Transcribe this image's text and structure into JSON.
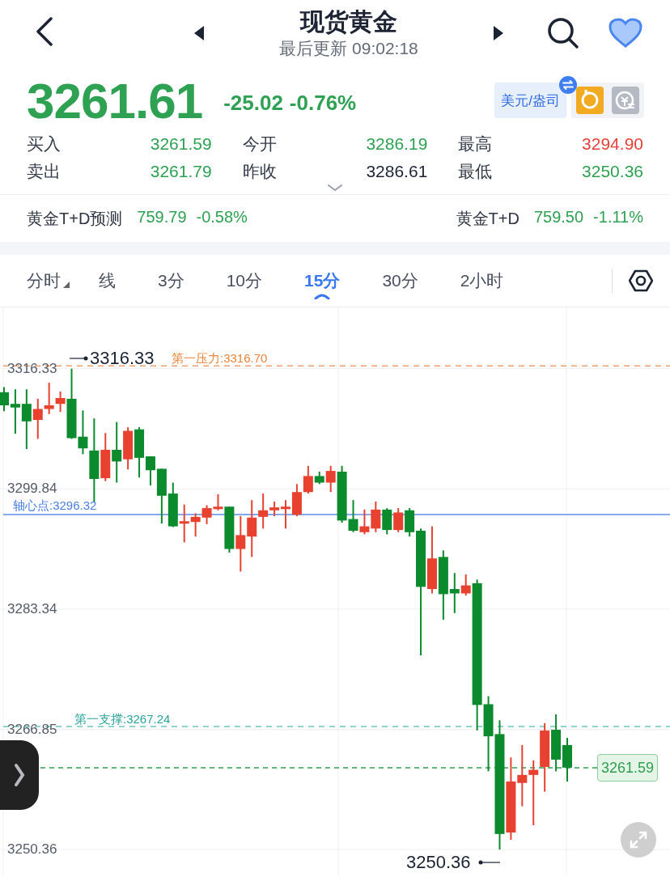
{
  "header": {
    "title": "现货黄金",
    "subtitle": "最后更新 09:02:18",
    "favorite": true
  },
  "quote": {
    "price": "3261.61",
    "change": "-25.02",
    "change_percent": "-0.76%",
    "color": "#2ea152",
    "unit_button": "美元/盎司"
  },
  "stats": [
    {
      "label": "买入",
      "value": "3261.59",
      "color": "#2ea152"
    },
    {
      "label": "今开",
      "value": "3286.19",
      "color": "#2ea152"
    },
    {
      "label": "最高",
      "value": "3294.90",
      "color": "#e5423a"
    },
    {
      "label": "卖出",
      "value": "3261.79",
      "color": "#2ea152"
    },
    {
      "label": "昨收",
      "value": "3286.61",
      "color": "#1c2333"
    },
    {
      "label": "最低",
      "value": "3250.36",
      "color": "#2ea152"
    }
  ],
  "related": [
    {
      "name": "黄金T+D预测",
      "price": "759.79",
      "change_percent": "-0.58%",
      "color": "#2ea152"
    },
    {
      "name": "黄金T+D",
      "price": "759.50",
      "change_percent": "-1.11%",
      "color": "#2ea152"
    }
  ],
  "period_tabs": [
    {
      "label": "分时",
      "selected": false,
      "dropdown": true
    },
    {
      "label": "线",
      "selected": false,
      "dropdown": false
    },
    {
      "label": "3分",
      "selected": false,
      "dropdown": false
    },
    {
      "label": "10分",
      "selected": false,
      "dropdown": false
    },
    {
      "label": "15分",
      "selected": true,
      "dropdown": false
    },
    {
      "label": "30分",
      "selected": false,
      "dropdown": false
    },
    {
      "label": "2小时",
      "selected": false,
      "dropdown": false
    }
  ],
  "chart": {
    "high_marker": "3316.33",
    "low_marker": "3250.36",
    "chart_data": {
      "type": "candlestick",
      "categories": [
        null,
        null,
        null,
        null,
        null,
        null,
        null,
        null,
        null,
        null,
        null,
        null,
        null,
        null,
        null,
        null,
        null,
        null,
        null,
        null,
        null,
        null,
        null,
        null,
        null,
        null,
        null,
        null,
        null,
        null,
        null,
        null,
        null,
        null,
        null,
        null,
        null,
        null,
        null,
        null,
        null,
        null,
        null,
        null,
        null,
        null,
        null,
        null,
        null,
        null,
        null
      ],
      "yticks": [
        3316.33,
        3299.84,
        3283.34,
        3266.85,
        3250.36
      ],
      "ylim": [
        3246.82,
        3324.73
      ],
      "grid": true,
      "ref_lines": [
        {
          "axis": "y",
          "value": 3316.7,
          "color": "#f0a070",
          "label": "第一压力:3316.70"
        },
        {
          "axis": "y",
          "value": 3296.32,
          "color": "#5b8ee8",
          "label": "轴心点:3296.32"
        },
        {
          "axis": "y",
          "value": 3267.24,
          "color": "#6cc6c0",
          "label": "第一支撑:3267.24"
        },
        {
          "axis": "y",
          "value": 3261.59,
          "color": "#2f9e4f",
          "label": "3261.59"
        }
      ],
      "ohlc": [
        [
          3313.1,
          3313.8,
          3310.5,
          3311.3
        ],
        [
          3311.5,
          3313.5,
          3307.4,
          3311.0
        ],
        [
          3311.5,
          3313.5,
          3305.3,
          3309.1
        ],
        [
          3309.3,
          3312.2,
          3306.7,
          3310.8
        ],
        [
          3310.8,
          3314.4,
          3310.1,
          3311.3
        ],
        [
          3311.5,
          3313.2,
          3310.4,
          3312.3
        ],
        [
          3312.2,
          3316.33,
          3306.7,
          3306.8
        ],
        [
          3307.0,
          3310.6,
          3304.6,
          3305.4
        ],
        [
          3305.1,
          3309.5,
          3298.0,
          3301.2
        ],
        [
          3301.3,
          3307.5,
          3300.9,
          3305.2
        ],
        [
          3305.2,
          3309.0,
          3300.7,
          3303.6
        ],
        [
          3303.9,
          3308.3,
          3302.5,
          3307.8
        ],
        [
          3308.0,
          3308.3,
          3301.4,
          3304.1
        ],
        [
          3304.3,
          3304.3,
          3300.3,
          3302.4
        ],
        [
          3302.6,
          3302.6,
          3295.1,
          3298.9
        ],
        [
          3299.2,
          3300.7,
          3294.6,
          3294.7
        ],
        [
          3295.1,
          3297.7,
          3292.5,
          3295.4
        ],
        [
          3295.3,
          3296.5,
          3293.3,
          3296.0
        ],
        [
          3295.9,
          3297.6,
          3295.0,
          3297.2
        ],
        [
          3297.1,
          3299.1,
          3296.9,
          3297.4
        ],
        [
          3297.4,
          3297.4,
          3291.1,
          3291.6
        ],
        [
          3291.6,
          3296.1,
          3288.5,
          3293.5
        ],
        [
          3293.3,
          3298.3,
          3290.5,
          3295.9
        ],
        [
          3296.0,
          3299.2,
          3294.4,
          3296.9
        ],
        [
          3296.9,
          3298.1,
          3296.1,
          3297.3
        ],
        [
          3297.1,
          3298.3,
          3294.4,
          3297.4
        ],
        [
          3296.3,
          3300.5,
          3296.1,
          3299.4
        ],
        [
          3299.4,
          3303.0,
          3299.2,
          3301.6
        ],
        [
          3301.6,
          3302.2,
          3300.5,
          3300.7
        ],
        [
          3300.7,
          3303.0,
          3299.4,
          3302.3
        ],
        [
          3302.2,
          3303.0,
          3295.2,
          3295.5
        ],
        [
          3295.7,
          3298.3,
          3293.9,
          3294.1
        ],
        [
          3293.9,
          3297.0,
          3293.6,
          3294.7
        ],
        [
          3294.4,
          3298.1,
          3293.9,
          3297.0
        ],
        [
          3297.0,
          3297.2,
          3293.6,
          3294.2
        ],
        [
          3294.2,
          3297.2,
          3293.9,
          3296.6
        ],
        [
          3296.9,
          3297.2,
          3293.3,
          3293.9
        ],
        [
          3294.1,
          3294.4,
          3277.0,
          3286.4
        ],
        [
          3286.1,
          3294.7,
          3285.5,
          3290.3
        ],
        [
          3290.5,
          3291.4,
          3281.9,
          3285.4
        ],
        [
          3286.1,
          3288.3,
          3282.8,
          3285.5
        ],
        [
          3285.5,
          3288.1,
          3285.2,
          3286.6
        ],
        [
          3286.9,
          3287.4,
          3266.7,
          3270.2
        ],
        [
          3270.3,
          3271.4,
          3261.1,
          3265.9
        ],
        [
          3266.2,
          3268.1,
          3250.36,
          3252.5
        ],
        [
          3252.7,
          3263.0,
          3251.7,
          3259.7
        ],
        [
          3259.5,
          3264.7,
          3256.3,
          3260.6
        ],
        [
          3260.6,
          3262.6,
          3253.7,
          3261.3
        ],
        [
          3261.7,
          3267.7,
          3258.3,
          3266.7
        ],
        [
          3266.8,
          3268.9,
          3261.1,
          3262.7
        ],
        [
          3264.7,
          3265.7,
          3259.7,
          3261.6
        ]
      ]
    }
  }
}
